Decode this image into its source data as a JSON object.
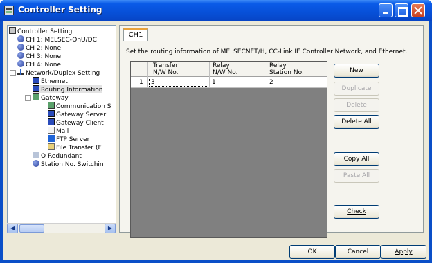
{
  "window": {
    "title": "Controller Setting"
  },
  "tree": {
    "items": [
      {
        "label": "Controller Setting"
      },
      {
        "label": "CH 1: MELSEC-QnU/DC"
      },
      {
        "label": "CH 2: None"
      },
      {
        "label": "CH 3: None"
      },
      {
        "label": "CH 4: None"
      },
      {
        "label": "Network/Duplex Setting"
      },
      {
        "label": "Ethernet"
      },
      {
        "label": "Routing Information"
      },
      {
        "label": "Gateway"
      },
      {
        "label": "Communication S"
      },
      {
        "label": "Gateway Server"
      },
      {
        "label": "Gateway Client"
      },
      {
        "label": "Mail"
      },
      {
        "label": "FTP Server"
      },
      {
        "label": "File Transfer (F"
      },
      {
        "label": "Q Redundant"
      },
      {
        "label": "Station No. Switchin"
      }
    ],
    "scroll_thumb_label": "..."
  },
  "tab": {
    "label": "CH1"
  },
  "description": "Set the routing information of MELSECNET/H, CC-Link IE Controller Network, and Ethernet.",
  "table": {
    "headers": [
      {
        "l1": "Transfer",
        "l2": "N/W No."
      },
      {
        "l1": "Relay",
        "l2": "N/W No."
      },
      {
        "l1": "Relay",
        "l2": "Station No."
      }
    ],
    "rows": [
      {
        "num": "1",
        "transfer": "3",
        "relay_nw": "1",
        "relay_station": "2"
      }
    ]
  },
  "side_buttons": {
    "new": "New",
    "duplicate": "Duplicate",
    "delete": "Delete",
    "delete_all": "Delete All",
    "copy_all": "Copy All",
    "paste_all": "Paste All",
    "check": "Check"
  },
  "footer": {
    "ok": "OK",
    "cancel": "Cancel",
    "apply": "Apply"
  },
  "colors": {
    "title_bar": "#0750d8",
    "dialog_bg": "#ece9d8",
    "tab_accent": "#e8a23a"
  }
}
